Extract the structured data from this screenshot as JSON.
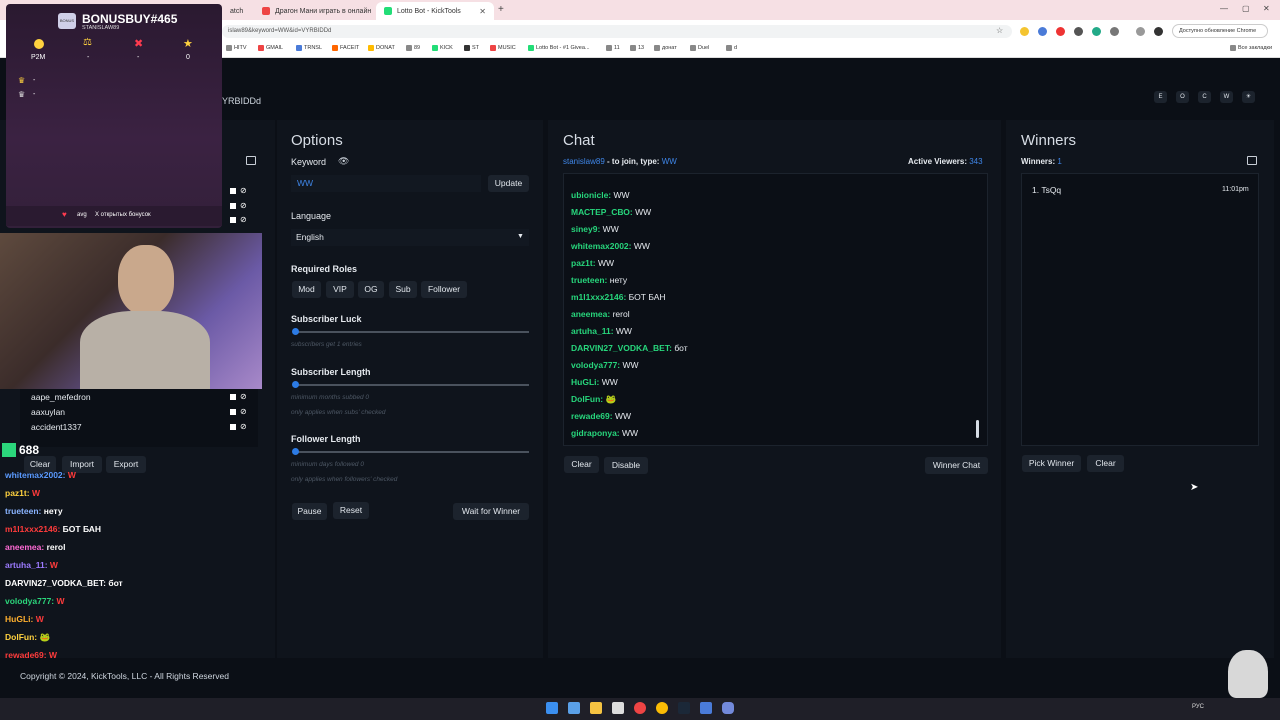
{
  "browser": {
    "tabs": [
      {
        "label": "atch"
      },
      {
        "label": "Драгон Мани играть в онлайн"
      },
      {
        "label": "Lotto Bot - KickTools"
      }
    ],
    "url": "islaw89&keyword=WW&id=VYRBIDDd",
    "bookmarks": [
      "HITV",
      "GMAIL",
      "TRNSL",
      "FACEIT",
      "DONAT",
      "89",
      "KICK",
      "ST",
      "MUSIC",
      "Lotto Bot - #1 Givea...",
      "11",
      "13",
      "донат",
      "Duel",
      "d"
    ],
    "all_bookmarks": "Все закладки",
    "update_label": "Доступно обновление Chrome"
  },
  "overlay": {
    "title": "BONUSBUY#465",
    "subtitle": "STANISLAW89",
    "stats": [
      {
        "icon": "coin-icon",
        "value": "P2M"
      },
      {
        "icon": "balance-icon",
        "value": "-"
      },
      {
        "icon": "cross-icon",
        "value": "-"
      },
      {
        "icon": "star-icon",
        "value": "0"
      }
    ],
    "crowns": [
      "-",
      "-"
    ],
    "footer_avg": "avg",
    "footer_open": "X открытых бонусок"
  },
  "page": {
    "id_fragment": "YRBIDDd",
    "top_buttons": [
      "E",
      "O",
      "C",
      "W",
      "☀"
    ],
    "user_list": [
      "aape_mefedron",
      "aaxuylan",
      "accident1337"
    ],
    "user_actions": {
      "clear": "Clear",
      "import": "Import",
      "export": "Export"
    },
    "viewer_count": "688"
  },
  "options": {
    "title": "Options",
    "keyword_label": "Keyword",
    "keyword_value": "WW",
    "update": "Update",
    "language_label": "Language",
    "language_value": "English",
    "roles_label": "Required Roles",
    "roles": [
      "Mod",
      "VIP",
      "OG",
      "Sub",
      "Follower"
    ],
    "sub_luck_label": "Subscriber Luck",
    "sub_luck_note": "subscribers get 1 entries",
    "sub_luck_value": 0,
    "sub_length_label": "Subscriber Length",
    "sub_length_note1": "minimum months subbed 0",
    "sub_length_note2": "only applies when subs' checked",
    "sub_length_value": 0,
    "follow_label": "Follower Length",
    "follow_note1": "minimum days followed 0",
    "follow_note2": "only applies when followers' checked",
    "follow_value": 0,
    "pause": "Pause",
    "reset": "Reset",
    "wait": "Wait for Winner"
  },
  "chat": {
    "title": "Chat",
    "join_user": "stanislaw89",
    "join_text": " - to join, type: ",
    "join_keyword": "WW",
    "viewers_label": "Active Viewers:",
    "viewers_value": "343",
    "messages": [
      {
        "user": "ubionicle:",
        "text": "WW"
      },
      {
        "user": "МАСТЕР_СВО:",
        "text": "WW"
      },
      {
        "user": "siney9:",
        "text": "WW"
      },
      {
        "user": "whitemax2002:",
        "text": "WW"
      },
      {
        "user": "paz1t:",
        "text": "WW"
      },
      {
        "user": "trueteen:",
        "text": "нету"
      },
      {
        "user": "m1l1xxx2146:",
        "text": "БОТ БАН"
      },
      {
        "user": "aneemea:",
        "text": "rerol"
      },
      {
        "user": "artuha_11:",
        "text": "WW"
      },
      {
        "user": "DARVIN27_VODKA_BET:",
        "text": "бот"
      },
      {
        "user": "volodya777:",
        "text": "WW"
      },
      {
        "user": "HuGLi:",
        "text": "WW"
      },
      {
        "user": "DolFun:",
        "text": "🐸"
      },
      {
        "user": "rewade69:",
        "text": "WW"
      },
      {
        "user": "gidraponya:",
        "text": "WW"
      }
    ],
    "clear": "Clear",
    "disable": "Disable",
    "winner_chat": "Winner Chat"
  },
  "winners": {
    "title": "Winners",
    "count_label": "Winners:",
    "count": "1",
    "list": [
      {
        "rank": "1.",
        "name": "TsQq",
        "time": "11:01pm"
      }
    ],
    "pick": "Pick Winner",
    "clear": "Clear"
  },
  "stream_chat": [
    {
      "user": "whitemax2002:",
      "text": "W",
      "color": "#5b9bff"
    },
    {
      "user": "paz1t:",
      "text": "W",
      "color": "#ffd23f"
    },
    {
      "user": "trueteen:",
      "text": "нету",
      "color": "#8ab4ff"
    },
    {
      "user": "m1l1xxx2146:",
      "text": "БОТ БАН",
      "color": "#ff3b3b"
    },
    {
      "user": "aneemea:",
      "text": "rerol",
      "color": "#ff6ad5"
    },
    {
      "user": "artuha_11:",
      "text": "W",
      "color": "#9c7bff"
    },
    {
      "user": "DARVIN27_VODKA_BET:",
      "text": "бот",
      "color": "#ffffff"
    },
    {
      "user": "volodya777:",
      "text": "W",
      "color": "#2bd67b"
    },
    {
      "user": "HuGLi:",
      "text": "W",
      "color": "#ffb02e"
    },
    {
      "user": "DolFun:",
      "text": "🐸",
      "color": "#ffd23f"
    },
    {
      "user": "rewade69:",
      "text": "W",
      "color": "#ff3b3b"
    }
  ],
  "footer": "Copyright © 2024, KickTools, LLC - All Rights Reserved",
  "taskbar": {
    "lang": "РУС"
  }
}
